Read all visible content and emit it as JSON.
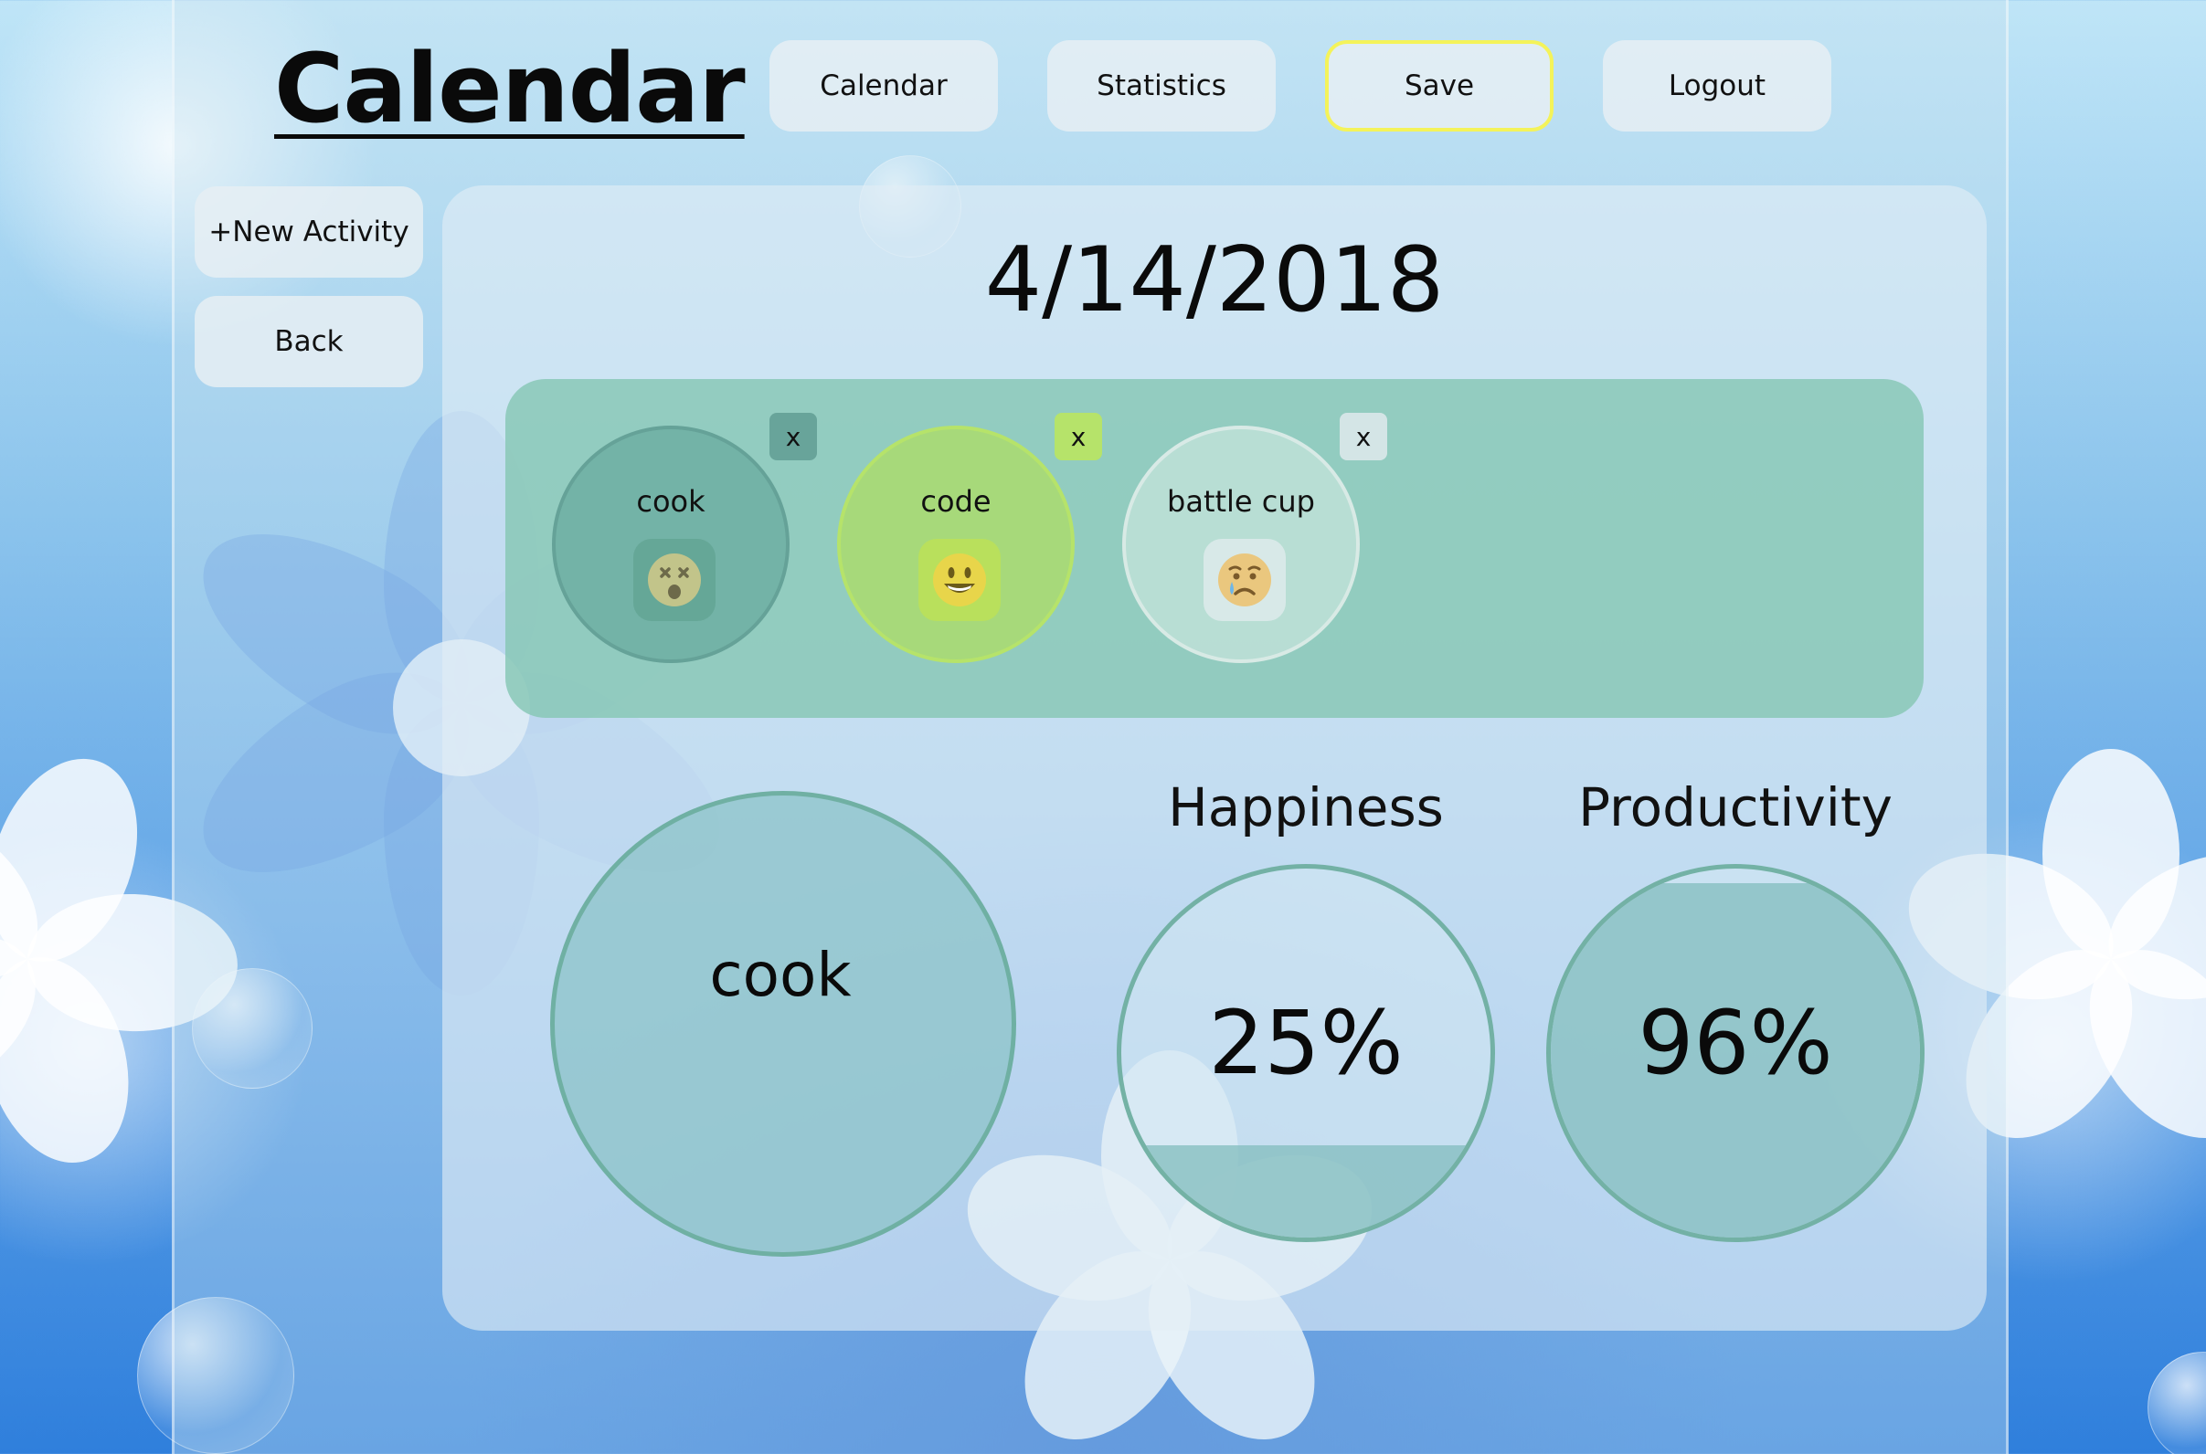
{
  "header": {
    "title": "Calendar",
    "nav": [
      {
        "label": "Calendar"
      },
      {
        "label": "Statistics"
      },
      {
        "label": "Save"
      },
      {
        "label": "Logout"
      }
    ]
  },
  "sidebar": {
    "new_activity_label": "+New Activity",
    "back_label": "Back"
  },
  "day": {
    "date": "4/14/2018"
  },
  "activities": [
    {
      "name": "cook",
      "emoji": "dizzy-face-icon",
      "remove_label": "x",
      "color": "#7ab8ab"
    },
    {
      "name": "code",
      "emoji": "grinning-face-icon",
      "remove_label": "x",
      "color": "#a6d97a"
    },
    {
      "name": "battle cup",
      "emoji": "crying-face-icon",
      "remove_label": "x",
      "color": "#bfe0d8"
    }
  ],
  "selected": {
    "name_value": "cook"
  },
  "metrics": {
    "happiness": {
      "label": "Happiness",
      "value": "25%",
      "fraction": 0.25
    },
    "productivity": {
      "label": "Productivity",
      "value": "96%",
      "fraction": 0.96
    }
  },
  "colors": {
    "active_nav_border": "#f4f35a",
    "ring": "#6eafa0",
    "strip": "#88c8b6"
  }
}
